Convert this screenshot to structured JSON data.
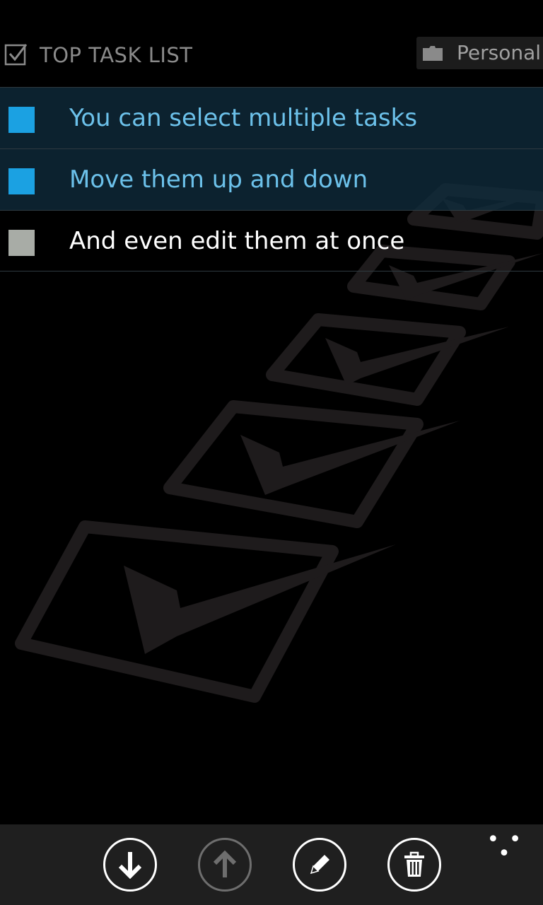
{
  "header": {
    "title": "TOP TASK LIST",
    "list_name": "Personal"
  },
  "tasks": [
    {
      "text": "You can select multiple tasks",
      "selected": true
    },
    {
      "text": "Move them up and down",
      "selected": true
    },
    {
      "text": "And even edit them at once",
      "selected": false
    }
  ],
  "colors": {
    "accent": "#1ba1e2",
    "selected_text": "#6cc1ea",
    "unselected_box": "#a8aca6",
    "text": "#ffffff"
  },
  "app_bar": {
    "buttons": [
      {
        "icon": "arrow-down-icon",
        "enabled": true
      },
      {
        "icon": "arrow-up-icon",
        "enabled": false
      },
      {
        "icon": "edit-icon",
        "enabled": true
      },
      {
        "icon": "delete-icon",
        "enabled": true
      }
    ],
    "more": "• • •"
  }
}
